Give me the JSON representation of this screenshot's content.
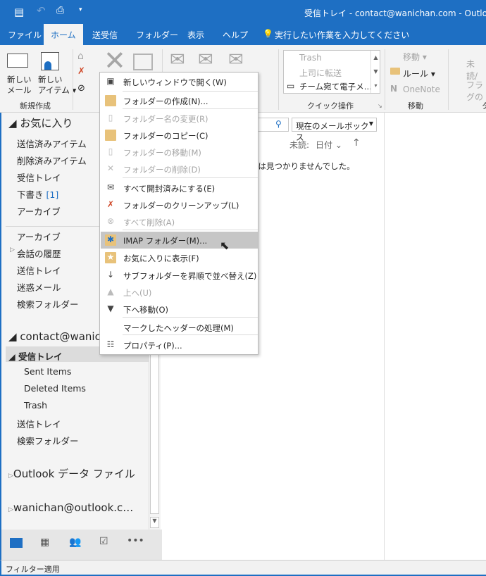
{
  "title": "受信トレイ - contact@wanichan.com  -  Outlook",
  "tabs": [
    "ファイル",
    "ホーム",
    "送受信",
    "フォルダー",
    "表示",
    "ヘルプ"
  ],
  "tell_me": "実行したい作業を入力してください",
  "ribbon": {
    "new_mail": [
      "新しい",
      "メール"
    ],
    "new_items": [
      "新しい",
      "アイテム ▾"
    ],
    "group_new": "新規作成",
    "quick_steps": [
      "Trash",
      "上司に転送",
      "チーム宛て電子メ…"
    ],
    "group_quick": "クイック操作",
    "move": "移動 ▾",
    "rules": "ルール ▾",
    "onenote": "OneNote",
    "group_move": "移動",
    "unread": "未読/",
    "flag": "フラグの",
    "group_tags": "タ"
  },
  "search": {
    "placeholder": "…",
    "scope": "現在のメールボックス"
  },
  "sort": {
    "label": "未読:",
    "field": "日付 ⌄",
    "arrow": "↑"
  },
  "empty_message": "ムは見つかりませんでした。",
  "folders": {
    "favorites_header": "お気に入り",
    "favorites": [
      "送信済みアイテム",
      "削除済みアイテム",
      "受信トレイ",
      "下書き",
      "アーカイブ"
    ],
    "drafts_count": "[1]",
    "other": [
      "アーカイブ",
      "会話の履歴",
      "送信トレイ",
      "迷惑メール",
      "検索フォルダー"
    ],
    "account": "contact@wanichan.com",
    "account_items": [
      "受信トレイ",
      "Sent Items",
      "Deleted Items",
      "Trash",
      "送信トレイ",
      "検索フォルダー"
    ],
    "data_file": "Outlook データ ファイル",
    "account2": "wanichan@outlook.c…"
  },
  "menu": [
    {
      "label": "新しいウィンドウで開く(W)",
      "enabled": true,
      "icon": "new-window-icon"
    },
    {
      "label": "フォルダーの作成(N)...",
      "enabled": true,
      "icon": "folder-icon"
    },
    {
      "label": "フォルダー名の変更(R)",
      "enabled": false,
      "icon": "rename-folder-icon"
    },
    {
      "label": "フォルダーのコピー(C)",
      "enabled": true,
      "icon": "copy-folder-icon"
    },
    {
      "label": "フォルダーの移動(M)",
      "enabled": false,
      "icon": "move-folder-icon"
    },
    {
      "label": "フォルダーの削除(D)",
      "enabled": false,
      "icon": "delete-folder-icon"
    },
    {
      "label": "すべて開封済みにする(E)",
      "enabled": true,
      "icon": "open-envelope-icon"
    },
    {
      "label": "フォルダーのクリーンアップ(L)",
      "enabled": true,
      "icon": "cleanup-icon"
    },
    {
      "label": "すべて削除(A)",
      "enabled": false,
      "icon": "delete-all-icon"
    },
    {
      "label": "IMAP フォルダー(M)...",
      "enabled": true,
      "icon": "imap-folder-icon",
      "highlighted": true
    },
    {
      "label": "お気に入りに表示(F)",
      "enabled": true,
      "icon": "favorite-folder-icon"
    },
    {
      "label": "サブフォルダーを昇順で並べ替え(Z)",
      "enabled": true,
      "icon": "sort-az-icon"
    },
    {
      "label": "上へ(U)",
      "enabled": false,
      "icon": "up-triangle-icon"
    },
    {
      "label": "下へ移動(O)",
      "enabled": true,
      "icon": "down-triangle-icon"
    },
    {
      "label": "マークしたヘッダーの処理(M)",
      "enabled": true,
      "icon": ""
    },
    {
      "label": "プロパティ(P)...",
      "enabled": true,
      "icon": "properties-icon"
    }
  ],
  "status": "フィルター適用",
  "colors": {
    "accent": "#1e6fc3",
    "highlight": "#c6c6c6",
    "folder": "#e8c27a"
  }
}
